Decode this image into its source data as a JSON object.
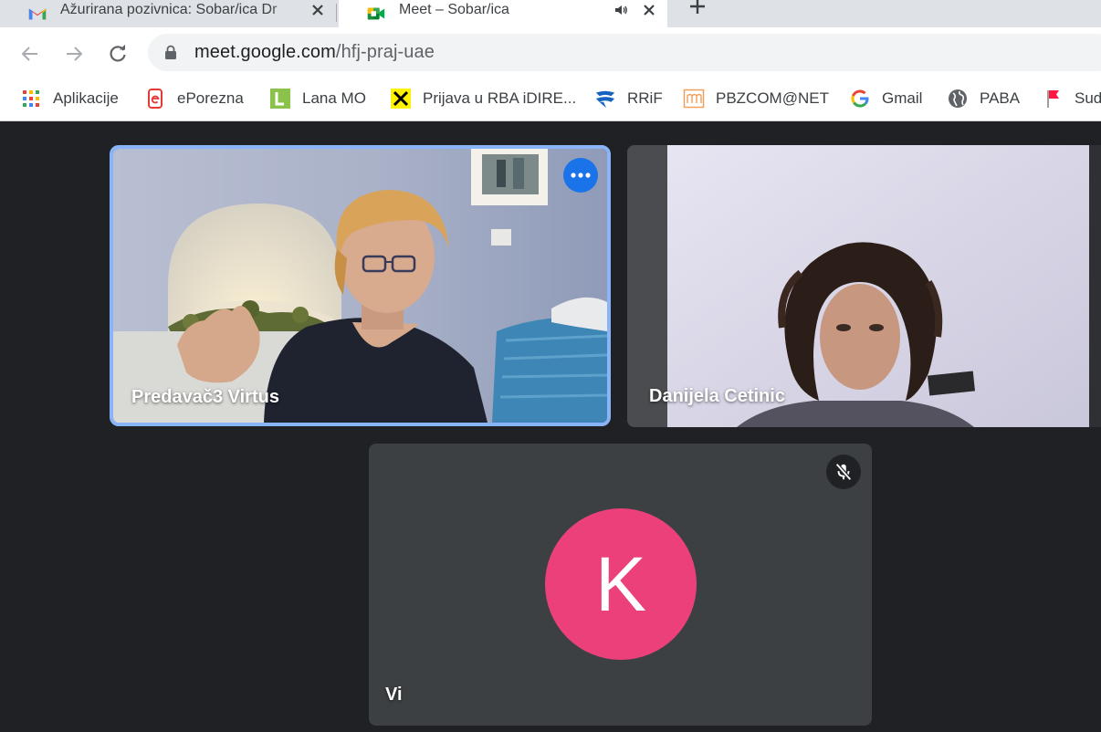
{
  "browser": {
    "tabs": [
      {
        "title": "Ažurirana pozivnica: Sobar/ica Dr"
      },
      {
        "title": "Meet – Sobar/ica"
      }
    ],
    "address": {
      "host": "meet.google.com",
      "path": "/hfj-praj-uae"
    }
  },
  "bookmarks": [
    {
      "label": "Aplikacije"
    },
    {
      "label": "ePorezna"
    },
    {
      "label": "Lana MO"
    },
    {
      "label": "Prijava u RBA iDIRE..."
    },
    {
      "label": "RRiF"
    },
    {
      "label": "PBZCOM@NET"
    },
    {
      "label": "Gmail"
    },
    {
      "label": "PABA"
    },
    {
      "label": "Sud"
    }
  ],
  "meet": {
    "participants": [
      {
        "name": "Predavač3 Virtus"
      },
      {
        "name": "Danijela Cetinic"
      },
      {
        "name": "Vi",
        "initial": "K",
        "avatar_color": "#ec407a"
      }
    ]
  },
  "colors": {
    "active_tile_border": "#8ab4f8",
    "accent": "#1a73e8",
    "stage": "#202124",
    "tile": "#3c4043"
  }
}
